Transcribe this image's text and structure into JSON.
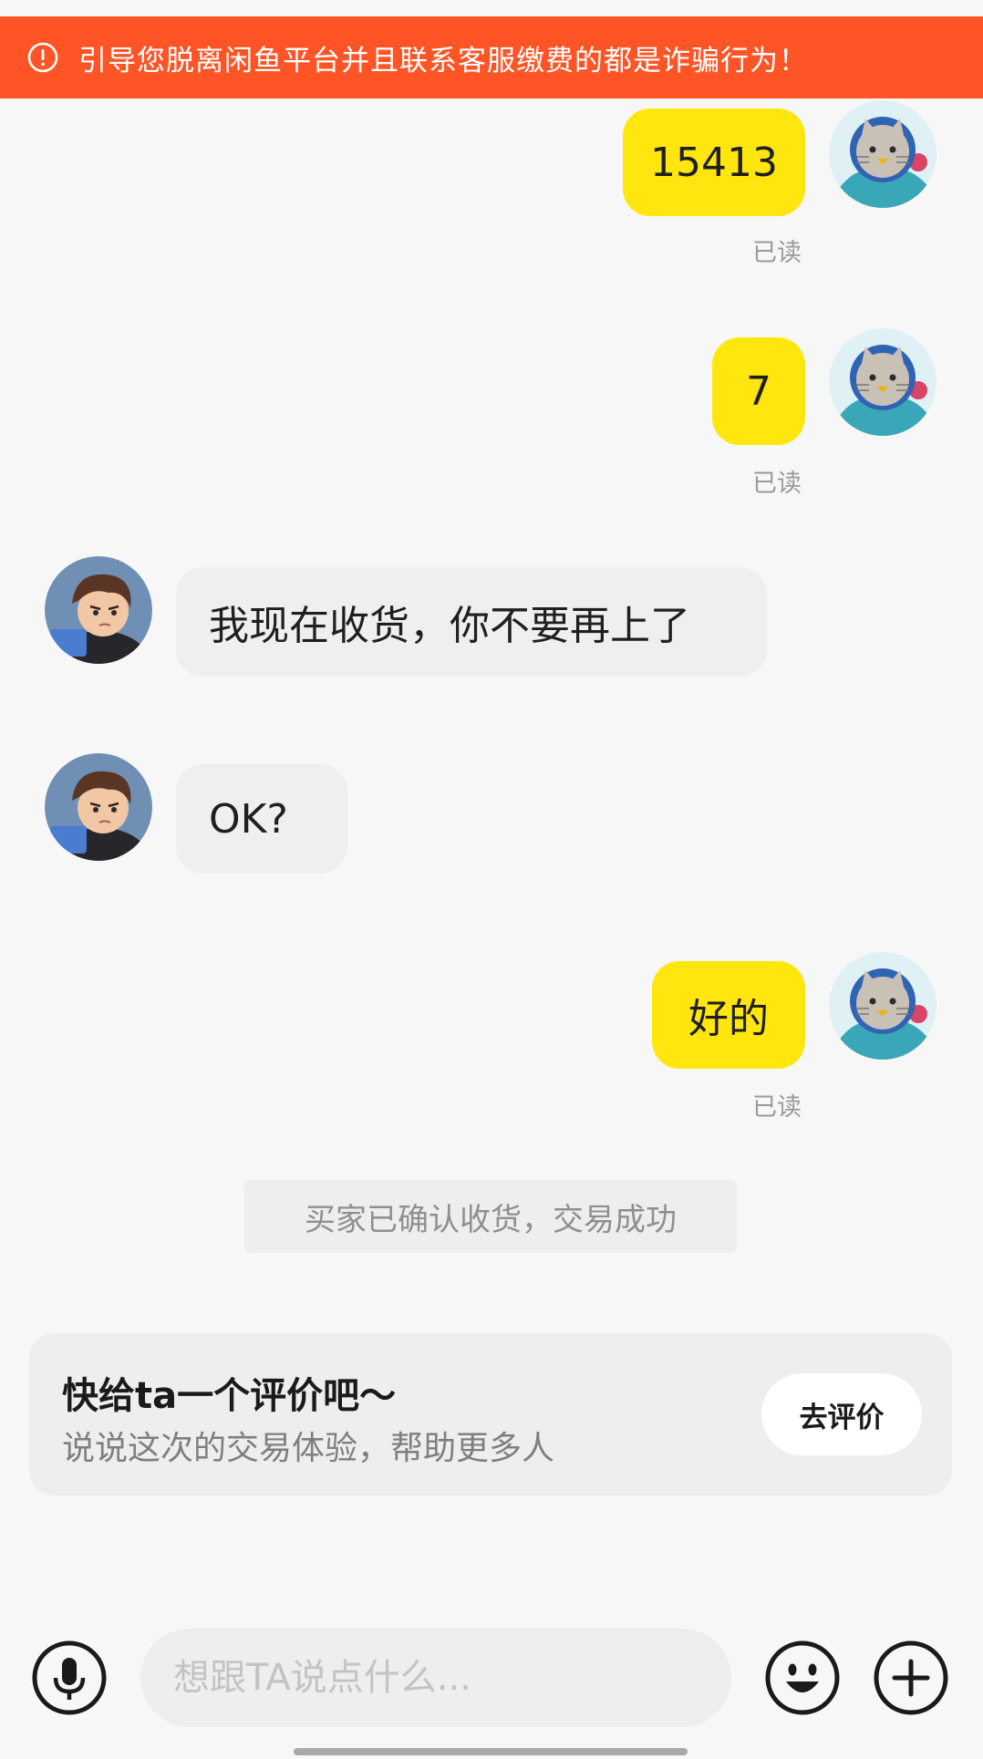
{
  "banner": {
    "warning_text": "引导您脱离闲鱼平台并且联系客服缴费的都是诈骗行为！",
    "icon": "alert-circle-icon",
    "color": "#ff5526"
  },
  "messages": [
    {
      "from": "me",
      "text": "15413",
      "status": "已读"
    },
    {
      "from": "me",
      "text": "7",
      "status": "已读"
    },
    {
      "from": "other",
      "text": "我现在收货，你不要再上了"
    },
    {
      "from": "other",
      "text": "OK?"
    },
    {
      "from": "me",
      "text": "好的",
      "status": "已读"
    }
  ],
  "system_notice": "买家已确认收货，交易成功",
  "review_card": {
    "title": "快给ta一个评价吧～",
    "subtitle": "说说这次的交易体验，帮助更多人",
    "button_label": "去评价"
  },
  "input_bar": {
    "placeholder": "想跟TA说点什么...",
    "mic_icon": "microphone-icon",
    "emoji_icon": "emoji-smile-icon",
    "plus_icon": "plus-circle-icon"
  },
  "colors": {
    "my_bubble": "#ffe60f",
    "their_bubble": "#efefef",
    "background": "#f7f7f7"
  }
}
